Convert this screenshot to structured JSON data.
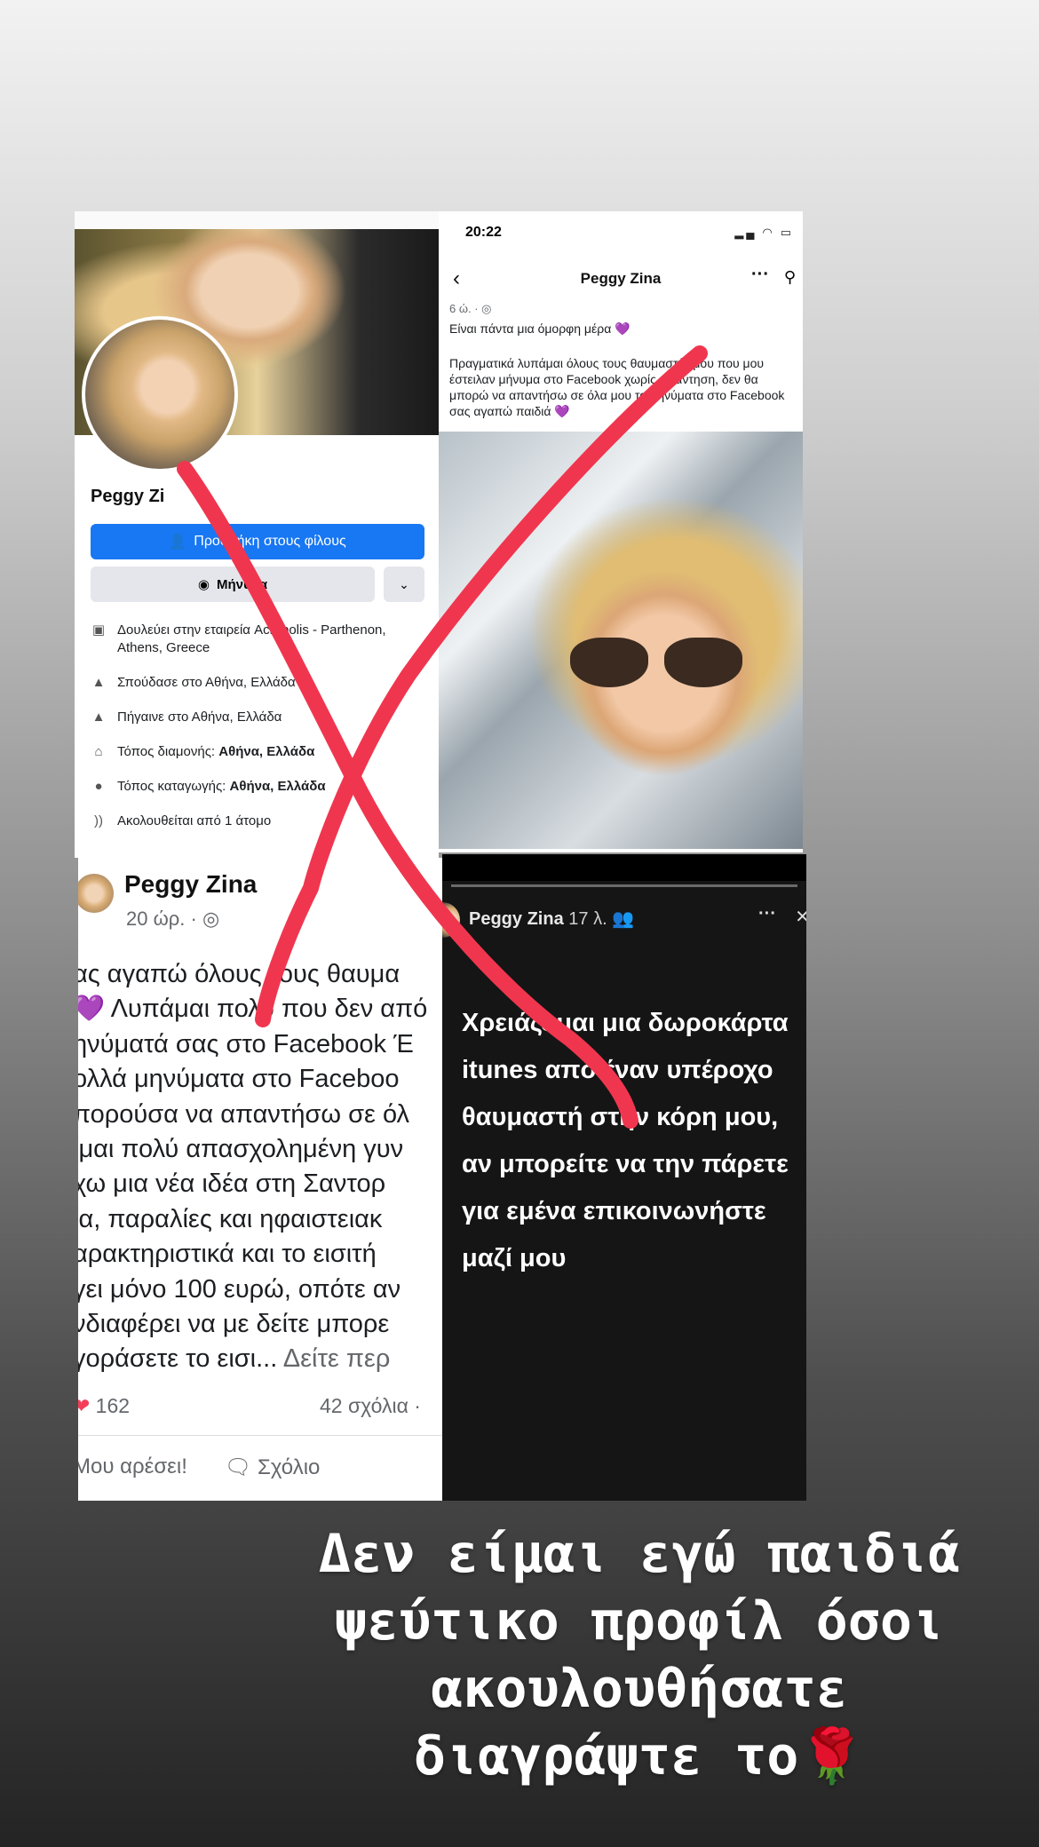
{
  "profile": {
    "name": "Peggy Zi",
    "add_friend": "Προσθήκη στους φίλους",
    "message": "Μήνυμα",
    "info": [
      {
        "icon": "briefcase-icon",
        "text": "Δουλεύει στην εταιρεία Acropolis - Parthenon, Athens, Greece",
        "bold": ""
      },
      {
        "icon": "graduation-cap-icon",
        "text": "Σπούδασε στο Αθήνα, Ελλάδα",
        "bold": ""
      },
      {
        "icon": "graduation-cap-icon",
        "text": "Πήγαινε στο Αθήνα, Ελλάδα",
        "bold": ""
      },
      {
        "icon": "home-icon",
        "text": "Τόπος διαμονής: ",
        "bold": "Αθήνα, Ελλάδα"
      },
      {
        "icon": "location-pin-icon",
        "text": "Τόπος καταγωγής: ",
        "bold": "Αθήνα, Ελλάδα"
      },
      {
        "icon": "rss-icon",
        "text": "Ακολουθείται από 1 άτομο",
        "bold": ""
      }
    ]
  },
  "phone_post": {
    "time": "20:22",
    "nav_title": "Peggy Zina",
    "meta": "6 ώ. ·",
    "line1": "Είναι πάντα μια όμορφη μέρα",
    "body": "Πραγματικά λυπάμαι όλους τους θαυμαστές μου που μου έστειλαν μήνυμα στο Facebook χωρίς απάντηση, δεν θα μπορώ να απαντήσω σε όλα μου τα μηνύματα στο Facebook σας αγαπώ παιδιά"
  },
  "post": {
    "name": "Peggy Zina",
    "time": "20 ώρ. ·",
    "lines": [
      "ας αγαπώ όλους τους θαυμα",
      "💜 Λυπάμαι πολύ που δεν από",
      "ηνύματά σας στο Facebook Έ",
      "ολλά μηνύματα στο Faceboo",
      "πορούσα να απαντήσω σε όλ",
      "ίμαι πολύ απασχολημένη γυν",
      "χω μια  νέα ιδέα στη Σαντορ",
      "ία, παραλίες και ηφαιστειακ",
      "αρακτηριστικά και το εισιτή",
      "γει μόνο 100 ευρώ, οπότε αν",
      "νδιαφέρει να με δείτε μπορε"
    ],
    "last_line": "γοράσετε το εισι...",
    "see_more": " Δείτε περ",
    "reactions": "162",
    "comments": "42 σχόλια ·",
    "like": "Μου αρέσει!",
    "comment": "Σχόλιο"
  },
  "story": {
    "name": "Peggy Zina",
    "time": "17 λ.",
    "text": "Χρειάζομαι μια δωροκάρτα itunes από έναν υπέροχο θαυμαστή στην κόρη μου, αν μπορείτε να την πάρετε για εμένα επικοινωνήστε μαζί μου"
  },
  "caption": {
    "line1": "Δεν είμαι εγώ παιδιά",
    "line2": "ψεύτικο προφίλ όσοι",
    "line3": "ακουλουθήσατε",
    "line4": "διαγράψτε το🌹"
  },
  "colors": {
    "fb_blue": "#1877f2",
    "x_red": "#f0364f",
    "story_bg": "#151515"
  }
}
